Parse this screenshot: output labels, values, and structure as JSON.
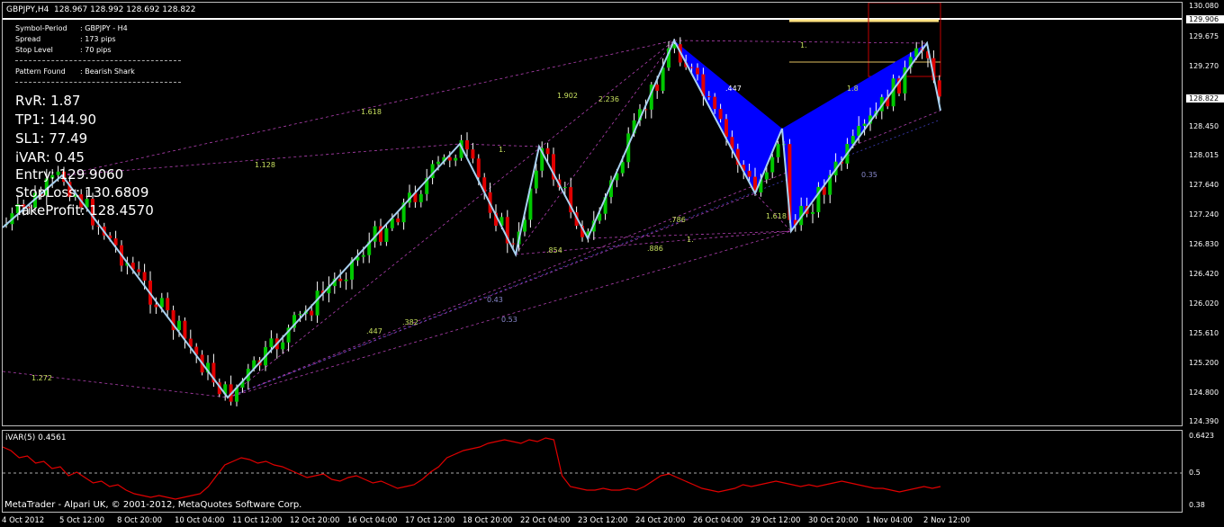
{
  "header": {
    "symbol_period": "GBPJPY,H4",
    "ohlc": "128.967 128.992 128.692 128.822"
  },
  "info": [
    {
      "key": "Symbol-Period",
      "value": ": GBPJPY - H4"
    },
    {
      "key": "Spread",
      "value": ": 173 pips"
    },
    {
      "key": "Stop Level",
      "value": ": 70 pips"
    },
    {
      "key": "Pattern Found",
      "value": ": Bearish Shark"
    }
  ],
  "trade": [
    "RvR: 1.87",
    "TP1: 144.90",
    "SL1: 77.49",
    "iVAR: 0.45",
    "Entry: 129.9060",
    "StopLoss: 130.6809",
    "TakeProfit: 128.4570"
  ],
  "price_axis": [
    "130.080",
    "129.906",
    "129.675",
    "129.270",
    "128.822",
    "128.450",
    "128.015",
    "127.640",
    "127.240",
    "126.830",
    "126.420",
    "126.020",
    "125.610",
    "125.200",
    "124.800",
    "124.390"
  ],
  "indicator": {
    "title": "iVAR(5) 0.4561",
    "axis": [
      "0.6423",
      "0.5",
      "0.38"
    ]
  },
  "time_axis": [
    "4 Oct 2012",
    "5 Oct 12:00",
    "8 Oct 20:00",
    "10 Oct 04:00",
    "11 Oct 12:00",
    "12 Oct 20:00",
    "16 Oct 04:00",
    "17 Oct 12:00",
    "18 Oct 20:00",
    "22 Oct 04:00",
    "23 Oct 12:00",
    "24 Oct 20:00",
    "26 Oct 04:00",
    "29 Oct 12:00",
    "30 Oct 20:00",
    "1 Nov 04:00",
    "2 Nov 12:00"
  ],
  "copyright": "MetaTrader - Alpari UK, © 2001-2012, MetaQuotes Software Corp.",
  "ratio_labels": [
    "1.618",
    "1.128",
    "1.902",
    "2.236",
    ".447",
    "1.",
    "1.",
    "1.",
    "1.618",
    ".786",
    ".886",
    ".854",
    "1.272",
    ".447",
    ".382",
    "0.43",
    "0.53",
    "0.35",
    "1.8"
  ],
  "colors": {
    "bull": "#00c800",
    "bear": "#e00000",
    "zigzag": "#a8d0f0",
    "pattern_fill": "#0000ff",
    "fib": "#b040b0",
    "indicator": "#e00000"
  }
}
